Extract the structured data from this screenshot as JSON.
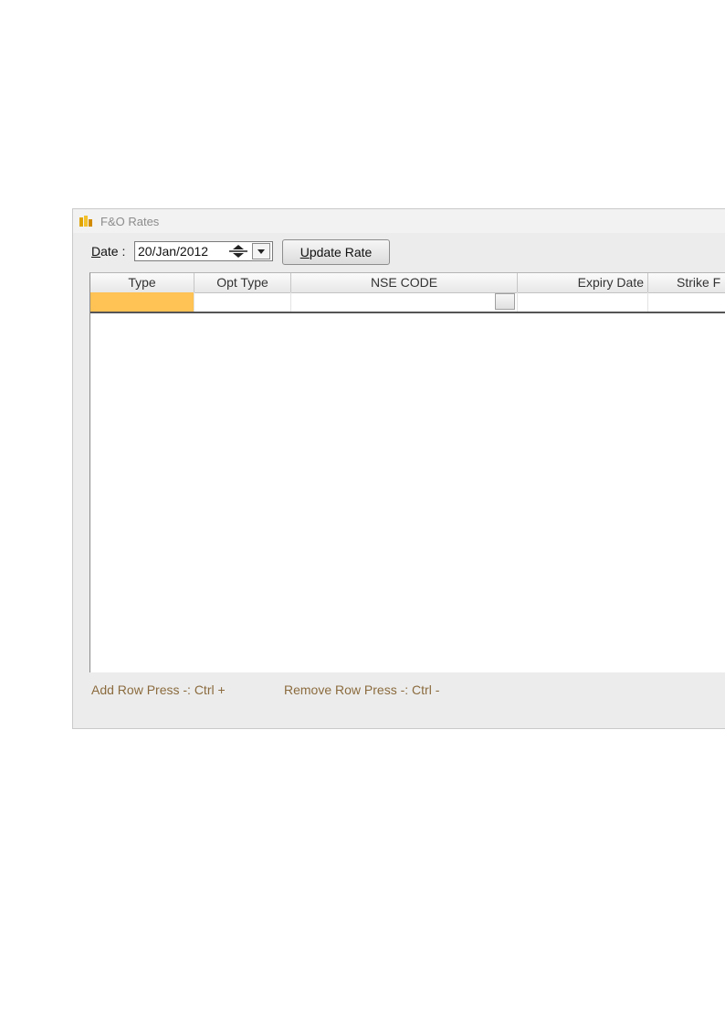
{
  "window": {
    "title": "F&O Rates"
  },
  "toolbar": {
    "date_label_underlined": "D",
    "date_label_rest": "ate :",
    "date_value": "20/Jan/2012",
    "update_button_underlined": "U",
    "update_button_rest": "pdate Rate"
  },
  "grid": {
    "columns": [
      "Type",
      "Opt Type",
      "NSE CODE",
      "Expiry Date",
      "Strike F"
    ],
    "rows": [
      [
        "",
        "",
        "",
        "",
        ""
      ]
    ]
  },
  "hints": {
    "add_row": "Add Row Press -: Ctrl +",
    "remove_row": "Remove Row Press -: Ctrl -"
  },
  "colors": {
    "selected_cell": "#ffc254",
    "hint_text": "#8b6b3e"
  },
  "icons": [
    "app-icon",
    "spinner-up-icon",
    "spinner-down-icon",
    "chevron-down-icon"
  ]
}
